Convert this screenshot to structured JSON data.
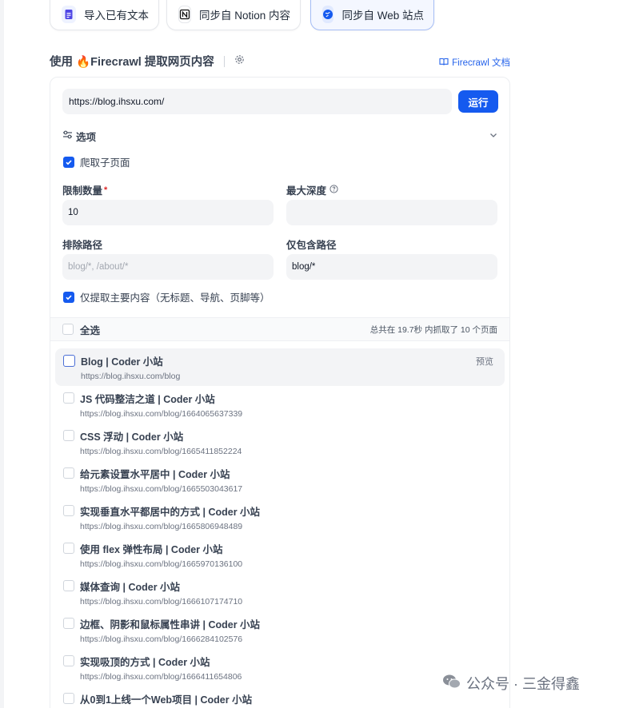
{
  "source_tabs": [
    {
      "label": "导入已有文本",
      "icon": "file-text-icon",
      "active": false
    },
    {
      "label": "同步自 Notion 内容",
      "icon": "notion-icon",
      "active": false
    },
    {
      "label": "同步自 Web 站点",
      "icon": "web-globe-icon",
      "active": true
    }
  ],
  "header": {
    "title": "使用 🔥Firecrawl 提取网页内容",
    "doc_link": "Firecrawl 文档"
  },
  "crawler": {
    "url_value": "https://blog.ihsxu.com/",
    "run_label": "运行",
    "options_label": "选项",
    "crawl_subpages_label": "爬取子页面",
    "limit_label": "限制数量",
    "limit_required_mark": "*",
    "limit_value": "10",
    "max_depth_label": "最大深度",
    "max_depth_value": "",
    "exclude_label": "排除路径",
    "exclude_placeholder": "blog/*, /about/*",
    "include_label": "仅包含路径",
    "include_value": "blog/*",
    "main_content_label": "仅提取主要内容（无标题、导航、页脚等）"
  },
  "results": {
    "select_all_label": "全选",
    "summary": "总共在 19.7秒 内抓取了 10 个页面",
    "preview_label": "预览",
    "items": [
      {
        "title": "Blog | Coder 小站",
        "url": "https://blog.ihsxu.com/blog"
      },
      {
        "title": "JS 代码整洁之道 | Coder 小站",
        "url": "https://blog.ihsxu.com/blog/1664065637339"
      },
      {
        "title": "CSS 浮动 | Coder 小站",
        "url": "https://blog.ihsxu.com/blog/1665411852224"
      },
      {
        "title": "给元素设置水平居中 | Coder 小站",
        "url": "https://blog.ihsxu.com/blog/1665503043617"
      },
      {
        "title": "实现垂直水平都居中的方式 | Coder 小站",
        "url": "https://blog.ihsxu.com/blog/1665806948489"
      },
      {
        "title": "使用 flex 弹性布局 | Coder 小站",
        "url": "https://blog.ihsxu.com/blog/1665970136100"
      },
      {
        "title": "媒体查询 | Coder 小站",
        "url": "https://blog.ihsxu.com/blog/1666107174710"
      },
      {
        "title": "边框、阴影和鼠标属性串讲 | Coder 小站",
        "url": "https://blog.ihsxu.com/blog/1666284102576"
      },
      {
        "title": "实现吸顶的方式 | Coder 小站",
        "url": "https://blog.ihsxu.com/blog/1666411654806"
      },
      {
        "title": "从0到1上线一个Web项目 | Coder 小站",
        "url": ""
      }
    ]
  },
  "watermark": "公众号 · 三金得鑫",
  "colors": {
    "accent": "#155aef",
    "required": "#dc2626"
  }
}
